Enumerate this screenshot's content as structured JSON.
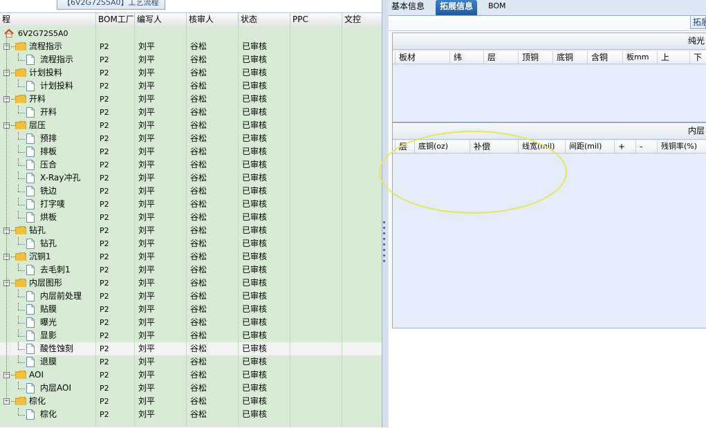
{
  "left_panel": {
    "title": "【6V2G72S5A0】工艺流程",
    "columns": [
      "程",
      "BOM工厂",
      "编写人",
      "核审人",
      "状态",
      "PPC",
      "文控"
    ],
    "root_label": "6V2G72S5A0",
    "rows": [
      {
        "label": "流程指示",
        "type": "folder",
        "factory": "P2",
        "writer": "刘平",
        "reviewer": "谷松",
        "status": "已审核"
      },
      {
        "label": "流程指示",
        "type": "doc",
        "factory": "P2",
        "writer": "刘平",
        "reviewer": "谷松",
        "status": "已审核"
      },
      {
        "label": "计划投料",
        "type": "folder",
        "factory": "P2",
        "writer": "刘平",
        "reviewer": "谷松",
        "status": "已审核"
      },
      {
        "label": "计划投料",
        "type": "doc",
        "factory": "P2",
        "writer": "刘平",
        "reviewer": "谷松",
        "status": "已审核"
      },
      {
        "label": "开料",
        "type": "folder",
        "factory": "P2",
        "writer": "刘平",
        "reviewer": "谷松",
        "status": "已审核"
      },
      {
        "label": "开料",
        "type": "doc",
        "factory": "P2",
        "writer": "刘平",
        "reviewer": "谷松",
        "status": "已审核"
      },
      {
        "label": "层压",
        "type": "folder",
        "factory": "P2",
        "writer": "刘平",
        "reviewer": "谷松",
        "status": "已审核"
      },
      {
        "label": "预排",
        "type": "doc",
        "factory": "P2",
        "writer": "刘平",
        "reviewer": "谷松",
        "status": "已审核"
      },
      {
        "label": "排板",
        "type": "doc",
        "factory": "P2",
        "writer": "刘平",
        "reviewer": "谷松",
        "status": "已审核"
      },
      {
        "label": "压合",
        "type": "doc",
        "factory": "P2",
        "writer": "刘平",
        "reviewer": "谷松",
        "status": "已审核"
      },
      {
        "label": "X-Ray冲孔",
        "type": "doc",
        "factory": "P2",
        "writer": "刘平",
        "reviewer": "谷松",
        "status": "已审核"
      },
      {
        "label": "铣边",
        "type": "doc",
        "factory": "P2",
        "writer": "刘平",
        "reviewer": "谷松",
        "status": "已审核"
      },
      {
        "label": "打字唛",
        "type": "doc",
        "factory": "P2",
        "writer": "刘平",
        "reviewer": "谷松",
        "status": "已审核"
      },
      {
        "label": "烘板",
        "type": "doc",
        "factory": "P2",
        "writer": "刘平",
        "reviewer": "谷松",
        "status": "已审核"
      },
      {
        "label": "钻孔",
        "type": "folder",
        "factory": "P2",
        "writer": "刘平",
        "reviewer": "谷松",
        "status": "已审核"
      },
      {
        "label": "钻孔",
        "type": "doc",
        "factory": "P2",
        "writer": "刘平",
        "reviewer": "谷松",
        "status": "已审核"
      },
      {
        "label": "沉铜1",
        "type": "folder",
        "factory": "P2",
        "writer": "刘平",
        "reviewer": "谷松",
        "status": "已审核"
      },
      {
        "label": "去毛刺1",
        "type": "doc",
        "factory": "P2",
        "writer": "刘平",
        "reviewer": "谷松",
        "status": "已审核"
      },
      {
        "label": "内层图形",
        "type": "folder",
        "factory": "P2",
        "writer": "刘平",
        "reviewer": "谷松",
        "status": "已审核"
      },
      {
        "label": "内层前处理",
        "type": "doc",
        "factory": "P2",
        "writer": "刘平",
        "reviewer": "谷松",
        "status": "已审核"
      },
      {
        "label": "贴膜",
        "type": "doc",
        "factory": "P2",
        "writer": "刘平",
        "reviewer": "谷松",
        "status": "已审核"
      },
      {
        "label": "曝光",
        "type": "doc",
        "factory": "P2",
        "writer": "刘平",
        "reviewer": "谷松",
        "status": "已审核"
      },
      {
        "label": "显影",
        "type": "doc",
        "factory": "P2",
        "writer": "刘平",
        "reviewer": "谷松",
        "status": "已审核"
      },
      {
        "label": "酸性蚀刻",
        "type": "doc",
        "factory": "P2",
        "writer": "刘平",
        "reviewer": "谷松",
        "status": "已审核",
        "selected": true
      },
      {
        "label": "退膜",
        "type": "doc",
        "factory": "P2",
        "writer": "刘平",
        "reviewer": "谷松",
        "status": "已审核"
      },
      {
        "label": "AOI",
        "type": "folder",
        "factory": "P2",
        "writer": "刘平",
        "reviewer": "谷松",
        "status": "已审核"
      },
      {
        "label": "内层AOI",
        "type": "doc",
        "factory": "P2",
        "writer": "刘平",
        "reviewer": "谷松",
        "status": "已审核"
      },
      {
        "label": "棕化",
        "type": "folder",
        "factory": "P2",
        "writer": "刘平",
        "reviewer": "谷松",
        "status": "已审核"
      },
      {
        "label": "棕化",
        "type": "doc",
        "factory": "P2",
        "writer": "刘平",
        "reviewer": "谷松",
        "status": "已审核"
      }
    ]
  },
  "right_panel": {
    "tabs": [
      {
        "label": "基本信息",
        "active": false
      },
      {
        "label": "拓展信息",
        "active": true
      },
      {
        "label": "BOM",
        "active": false
      }
    ],
    "extend_button": "拓展",
    "section1": {
      "title": "纯光",
      "columns": [
        "板材",
        "纬",
        "层",
        "顶铜",
        "底铜",
        "含铜",
        "板mm",
        "上",
        "下"
      ]
    },
    "section2": {
      "title": "内层",
      "columns": [
        "层",
        "底铜(oz)",
        "补偿",
        "线宽(mil)",
        "间距(mil)",
        "+",
        "-",
        "残铜率(%)"
      ]
    }
  },
  "colors": {
    "tree_background": "#d7ebd5",
    "selected_row": "#f3f3f3",
    "active_tab": "#2a6ab5",
    "section_background": "#e4edf9",
    "annotation_ellipse": "#e7e65a"
  }
}
